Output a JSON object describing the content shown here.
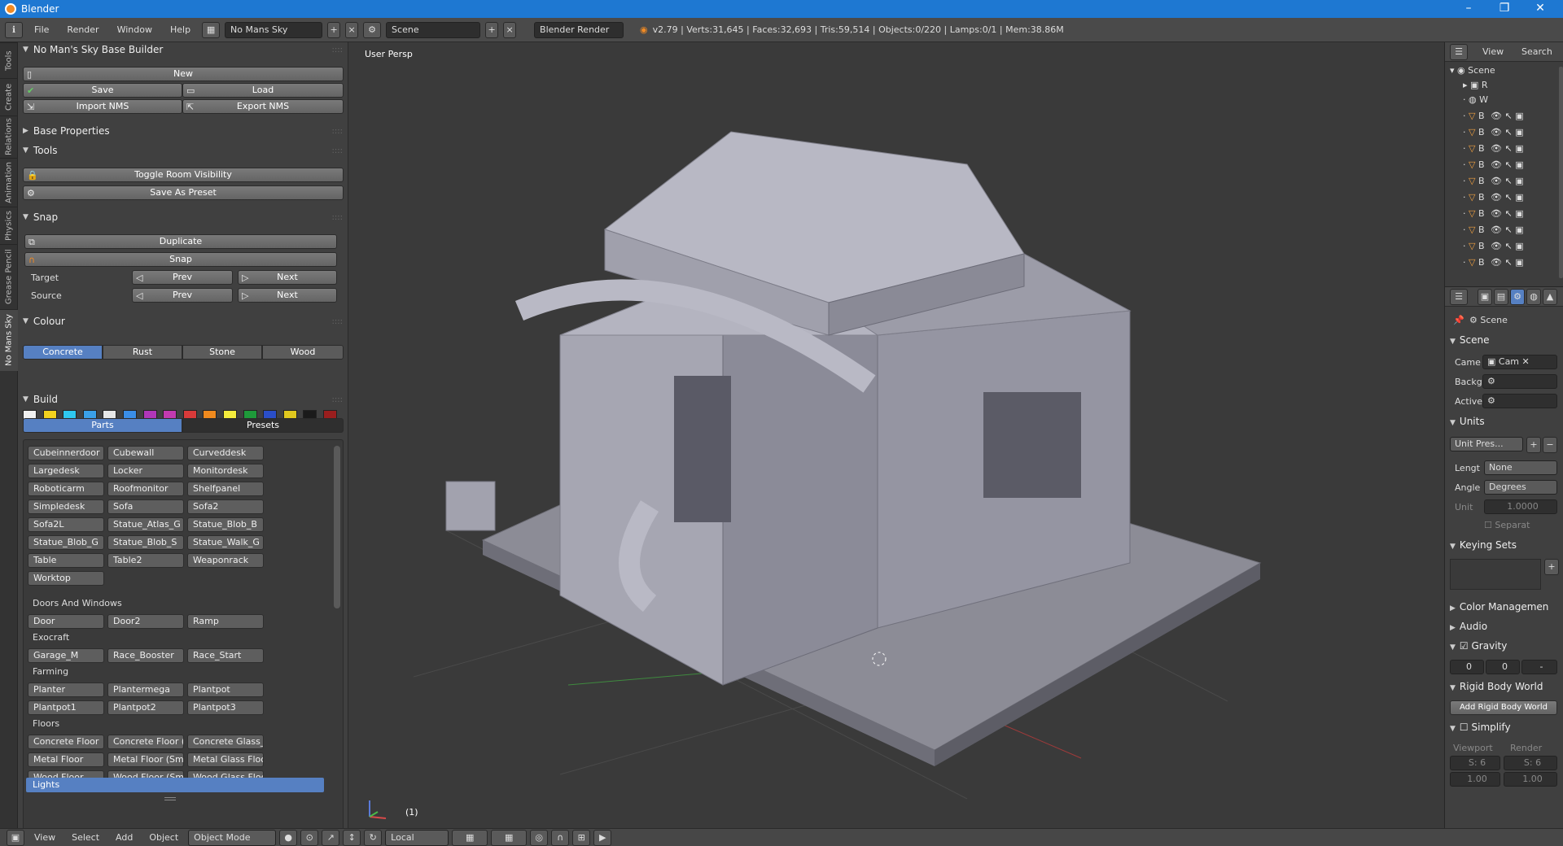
{
  "window": {
    "title": "Blender",
    "minimize": "–",
    "maximize": "❐",
    "close": "✕"
  },
  "infobar": {
    "menus": [
      "File",
      "Render",
      "Window",
      "Help"
    ],
    "screen": "No Mans Sky",
    "scene": "Scene",
    "engine": "Blender Render",
    "stats": "v2.79 | Verts:31,645 | Faces:32,693 | Tris:59,514 | Objects:0/220 | Lamps:0/1 | Mem:38.86M"
  },
  "vtabs": [
    "Tools",
    "Create",
    "Relations",
    "Animation",
    "Physics",
    "Grease Pencil",
    "No Mans Sky"
  ],
  "tool": {
    "main_panel": "No Man's Sky Base Builder",
    "new": "New",
    "save": "Save",
    "load": "Load",
    "import": "Import NMS",
    "export": "Export NMS",
    "base_properties": "Base Properties",
    "tools_panel": "Tools",
    "toggle_room": "Toggle Room Visibility",
    "save_preset": "Save As Preset",
    "snap_panel": "Snap",
    "duplicate": "Duplicate",
    "snap": "Snap",
    "target": "Target",
    "source": "Source",
    "prev": "Prev",
    "next": "Next",
    "colour_panel": "Colour",
    "materials": [
      "Concrete",
      "Rust",
      "Stone",
      "Wood"
    ],
    "swatches": [
      "#f0f0f0",
      "#f2d21e",
      "#2ec8f0",
      "#3aa0e8",
      "#e7e7e7",
      "#3a8ee8",
      "#b036b8",
      "#c23ab0",
      "#d83a3a",
      "#f08a1e",
      "#f4ec3c",
      "#1e9a3a",
      "#2a4ec8",
      "#e0c81e",
      "#1a1a1a",
      "#9a1e1e"
    ],
    "build_panel": "Build",
    "build_tabs": [
      "Parts",
      "Presets"
    ],
    "parts_top": [
      "Cubeinnerdoor",
      "Cubewall",
      "Curveddesk",
      "Largedesk",
      "Locker",
      "Monitordesk",
      "Roboticarm",
      "Roofmonitor",
      "Shelfpanel",
      "Simpledesk",
      "Sofa",
      "Sofa2",
      "Sofa2L",
      "Statue_Atlas_G",
      "Statue_Blob_B",
      "Statue_Blob_G",
      "Statue_Blob_S",
      "Statue_Walk_G",
      "Table",
      "Table2",
      "Weaponrack",
      "Worktop"
    ],
    "cat_doors": "Doors And Windows",
    "parts_doors": [
      "Door",
      "Door2",
      "Ramp"
    ],
    "cat_exocraft": "Exocraft",
    "parts_exocraft": [
      "Garage_M",
      "Race_Booster",
      "Race_Start"
    ],
    "cat_farming": "Farming",
    "parts_farming": [
      "Planter",
      "Plantermega",
      "Plantpot",
      "Plantpot1",
      "Plantpot2",
      "Plantpot3"
    ],
    "cat_floors": "Floors",
    "parts_floors": [
      "Concrete Floor",
      "Concrete Floor (S...",
      "Concrete Glass_Fl...",
      "Metal Floor",
      "Metal Floor (Small)",
      "Metal Glass Floor",
      "Wood Floor",
      "Wood Floor (Small)",
      "Wood Glass Floor"
    ],
    "lights": "Lights"
  },
  "viewport": {
    "label": "User Persp",
    "frame": "(1)"
  },
  "bottombar": {
    "menus": [
      "View",
      "Select",
      "Add",
      "Object"
    ],
    "mode": "Object Mode",
    "pivot": "Local"
  },
  "outliner": {
    "view": "View",
    "search": "Search",
    "scene": "Scene",
    "r": "R",
    "w": "W",
    "objects": [
      "B",
      "B",
      "B",
      "B",
      "B",
      "B",
      "B",
      "B",
      "B",
      "B"
    ]
  },
  "props": {
    "tab": "Scene",
    "scene_panel": "Scene",
    "camera_label": "Came",
    "camera_value": "Cam",
    "background_label": "Backg",
    "active_label": "Active",
    "units_panel": "Units",
    "unit_preset": "Unit Pres...",
    "length_label": "Lengt",
    "length_value": "None",
    "angle_label": "Angle",
    "angle_value": "Degrees",
    "unit_label": "Unit",
    "unit_value": "1.0000",
    "separate": "Separat",
    "keying_panel": "Keying Sets",
    "color_mgmt": "Color Managemen",
    "audio": "Audio",
    "gravity": "Gravity",
    "gravity_vals": [
      "0",
      "0",
      "-"
    ],
    "rigid_panel": "Rigid Body World",
    "add_rigid": "Add Rigid Body World",
    "simplify": "Simplify",
    "viewport": "Viewport",
    "render": "Render",
    "s_view": "S: 6",
    "s_render": "S: 6",
    "v1": "1.00",
    "v2": "1.00"
  }
}
